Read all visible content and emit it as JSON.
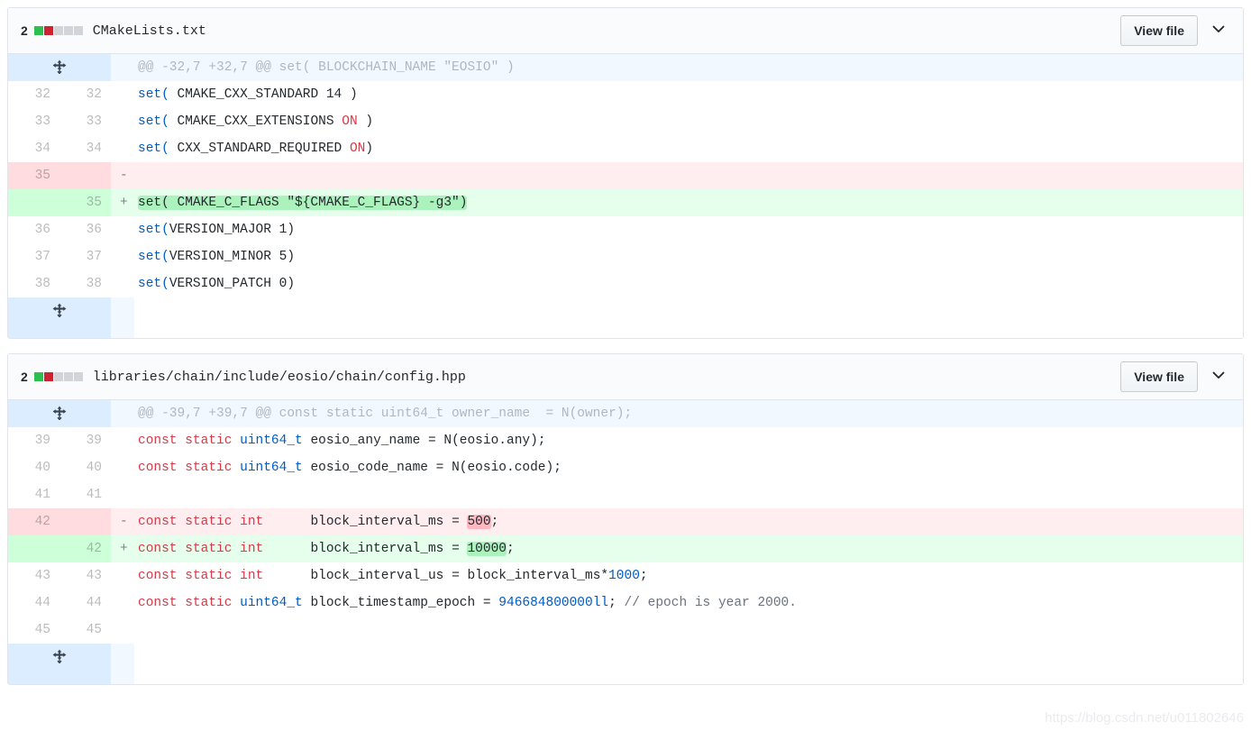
{
  "watermark": "https://blog.csdn.net/u011802646",
  "colors": {
    "addition_bg": "#e6ffed",
    "addition_gutter": "#cdffd8",
    "addition_word": "#acf2bd",
    "deletion_bg": "#ffeef0",
    "deletion_gutter": "#ffdce0",
    "deletion_word": "#fdb8c0",
    "hunk_bg": "#f1f8ff",
    "hunk_gutter": "#dbedff",
    "diffstat_add": "#2cbe4e",
    "diffstat_del": "#cb2431",
    "diffstat_none": "#d1d5da",
    "keyword": "#d73a49",
    "function": "#005cc5",
    "comment": "#6a737d"
  },
  "files": [
    {
      "changes_count": "2",
      "diffstat_blocks": [
        "add",
        "del",
        "none",
        "none",
        "none"
      ],
      "path": "CMakeLists.txt",
      "view_file_label": "View file",
      "hunk_header": "@@ -32,7 +32,7 @@ set( BLOCKCHAIN_NAME \"EOSIO\" )",
      "rows": [
        {
          "type": "context",
          "old": "32",
          "new": "32",
          "marker": "",
          "code": "set( CMAKE_CXX_STANDARD 14 )"
        },
        {
          "type": "context",
          "old": "33",
          "new": "33",
          "marker": "",
          "code": "set( CMAKE_CXX_EXTENSIONS ON )"
        },
        {
          "type": "context",
          "old": "34",
          "new": "34",
          "marker": "",
          "code": "set( CXX_STANDARD_REQUIRED ON)"
        },
        {
          "type": "deletion",
          "old": "35",
          "new": "",
          "marker": "-",
          "code": ""
        },
        {
          "type": "addition",
          "old": "",
          "new": "35",
          "marker": "+",
          "code": "set( CMAKE_C_FLAGS \"${CMAKE_C_FLAGS} -g3\")"
        },
        {
          "type": "context",
          "old": "36",
          "new": "36",
          "marker": "",
          "code": "set(VERSION_MAJOR 1)"
        },
        {
          "type": "context",
          "old": "37",
          "new": "37",
          "marker": "",
          "code": "set(VERSION_MINOR 5)"
        },
        {
          "type": "context",
          "old": "38",
          "new": "38",
          "marker": "",
          "code": "set(VERSION_PATCH 0)"
        }
      ]
    },
    {
      "changes_count": "2",
      "diffstat_blocks": [
        "add",
        "del",
        "none",
        "none",
        "none"
      ],
      "path": "libraries/chain/include/eosio/chain/config.hpp",
      "view_file_label": "View file",
      "hunk_header": "@@ -39,7 +39,7 @@ const static uint64_t owner_name  = N(owner);",
      "rows": [
        {
          "type": "context",
          "old": "39",
          "new": "39",
          "marker": "",
          "code": "const static uint64_t eosio_any_name = N(eosio.any);"
        },
        {
          "type": "context",
          "old": "40",
          "new": "40",
          "marker": "",
          "code": "const static uint64_t eosio_code_name = N(eosio.code);"
        },
        {
          "type": "context",
          "old": "41",
          "new": "41",
          "marker": "",
          "code": ""
        },
        {
          "type": "deletion",
          "old": "42",
          "new": "",
          "marker": "-",
          "code": "const static int      block_interval_ms = 500;"
        },
        {
          "type": "addition",
          "old": "",
          "new": "42",
          "marker": "+",
          "code": "const static int      block_interval_ms = 10000;"
        },
        {
          "type": "context",
          "old": "43",
          "new": "43",
          "marker": "",
          "code": "const static int      block_interval_us = block_interval_ms*1000;"
        },
        {
          "type": "context",
          "old": "44",
          "new": "44",
          "marker": "",
          "code": "const static uint64_t block_timestamp_epoch = 946684800000ll; // epoch is year 2000."
        },
        {
          "type": "context",
          "old": "45",
          "new": "45",
          "marker": "",
          "code": ""
        }
      ]
    }
  ]
}
